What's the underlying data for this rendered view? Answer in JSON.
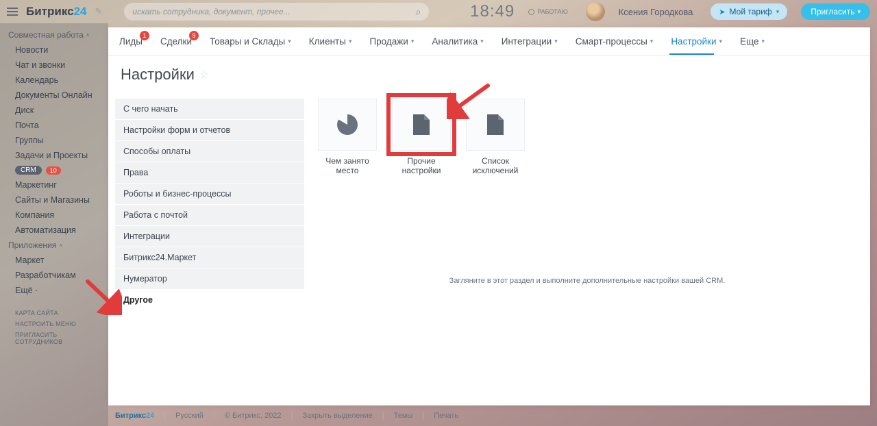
{
  "header": {
    "logo_part1": "Битрикс",
    "logo_part2": "24",
    "search_placeholder": "искать сотрудника, документ, прочее...",
    "clock": "18:49",
    "work_status": "РАБОТАЮ",
    "username": "Ксения Городкова",
    "tariff_label": "Мой тариф",
    "invite_label": "Пригласить"
  },
  "sidebar": {
    "group1_label": "Совместная работа",
    "items1": [
      "Новости",
      "Чат и звонки",
      "Календарь",
      "Документы Онлайн",
      "Диск",
      "Почта",
      "Группы",
      "Задачи и Проекты"
    ],
    "crm_label": "CRM",
    "crm_count": "10",
    "items2": [
      "Маркетинг",
      "Сайты и Магазины",
      "Компания",
      "Автоматизация"
    ],
    "group2_label": "Приложения",
    "items3": [
      "Маркет",
      "Разработчикам",
      "Ещё ·"
    ],
    "small": [
      "КАРТА САЙТА",
      "НАСТРОИТЬ МЕНЮ",
      "ПРИГЛАСИТЬ СОТРУДНИКОВ"
    ]
  },
  "tabs": {
    "items": [
      {
        "label": "Лиды",
        "badge": "1",
        "chev": false
      },
      {
        "label": "Сделки",
        "badge": "9",
        "chev": false
      },
      {
        "label": "Товары и Склады",
        "chev": true
      },
      {
        "label": "Клиенты",
        "chev": true
      },
      {
        "label": "Продажи",
        "chev": true
      },
      {
        "label": "Аналитика",
        "chev": true
      },
      {
        "label": "Интеграции",
        "chev": true
      },
      {
        "label": "Смарт-процессы",
        "chev": true
      },
      {
        "label": "Настройки",
        "chev": true,
        "active": true
      },
      {
        "label": "Еще",
        "chev": true
      }
    ]
  },
  "page": {
    "title": "Настройки",
    "menu": [
      "С чего начать",
      "Настройки форм и отчетов",
      "Способы оплаты",
      "Права",
      "Роботы и бизнес-процессы",
      "Работа с почтой",
      "Интеграции",
      "Битрикс24.Маркет",
      "Нумератор",
      "Другое"
    ],
    "menu_active_index": 9,
    "tiles": [
      {
        "label": "Чем занято место",
        "icon": "pie"
      },
      {
        "label": "Прочие настройки",
        "icon": "doc",
        "selected": true
      },
      {
        "label": "Список исключений",
        "icon": "doc"
      }
    ],
    "description": "Загляните в этот раздел и выполните дополнительные настройки вашей CRM."
  },
  "footer": {
    "b1": "Битрикс",
    "b2": "24",
    "lang": "Русский",
    "copyright": "© Битрикс, 2022",
    "l1": "Закрыть выделение",
    "l2": "Темы",
    "l3": "Печать"
  }
}
